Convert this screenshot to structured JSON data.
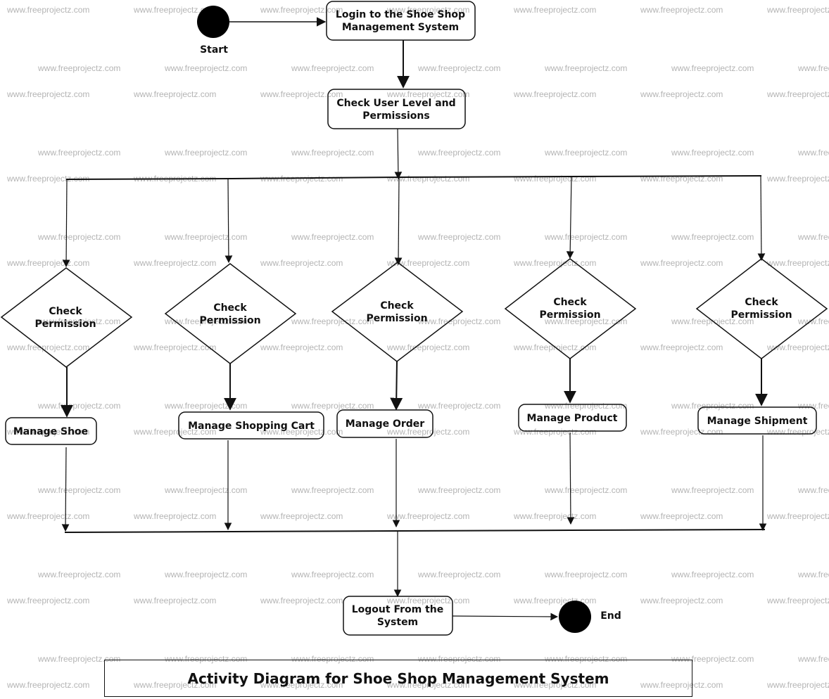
{
  "diagram": {
    "type": "uml-activity",
    "title": "Activity Diagram for Shoe Shop Management System",
    "watermark": "www.freeprojectz.com",
    "colors": {
      "stroke": "#111111",
      "watermark": "#b4b4b4",
      "background": "#ffffff"
    },
    "start": {
      "label": "Start"
    },
    "end": {
      "label": "End"
    },
    "login": {
      "lines": [
        "Login to the Shoe Shop",
        "Management System"
      ]
    },
    "check_level": {
      "lines": [
        "Check User Level and",
        "Permissions"
      ]
    },
    "branches": [
      {
        "decision": [
          "Check",
          "Permission"
        ],
        "action": "Manage Shoe"
      },
      {
        "decision": [
          "Check",
          "Permission"
        ],
        "action": "Manage Shopping Cart"
      },
      {
        "decision": [
          "Check",
          "Permission"
        ],
        "action": "Manage Order"
      },
      {
        "decision": [
          "Check",
          "Permission"
        ],
        "action": "Manage Product"
      },
      {
        "decision": [
          "Check",
          "Permission"
        ],
        "action": "Manage Shipment"
      }
    ],
    "logout": {
      "lines": [
        "Logout From the",
        "System"
      ]
    }
  }
}
